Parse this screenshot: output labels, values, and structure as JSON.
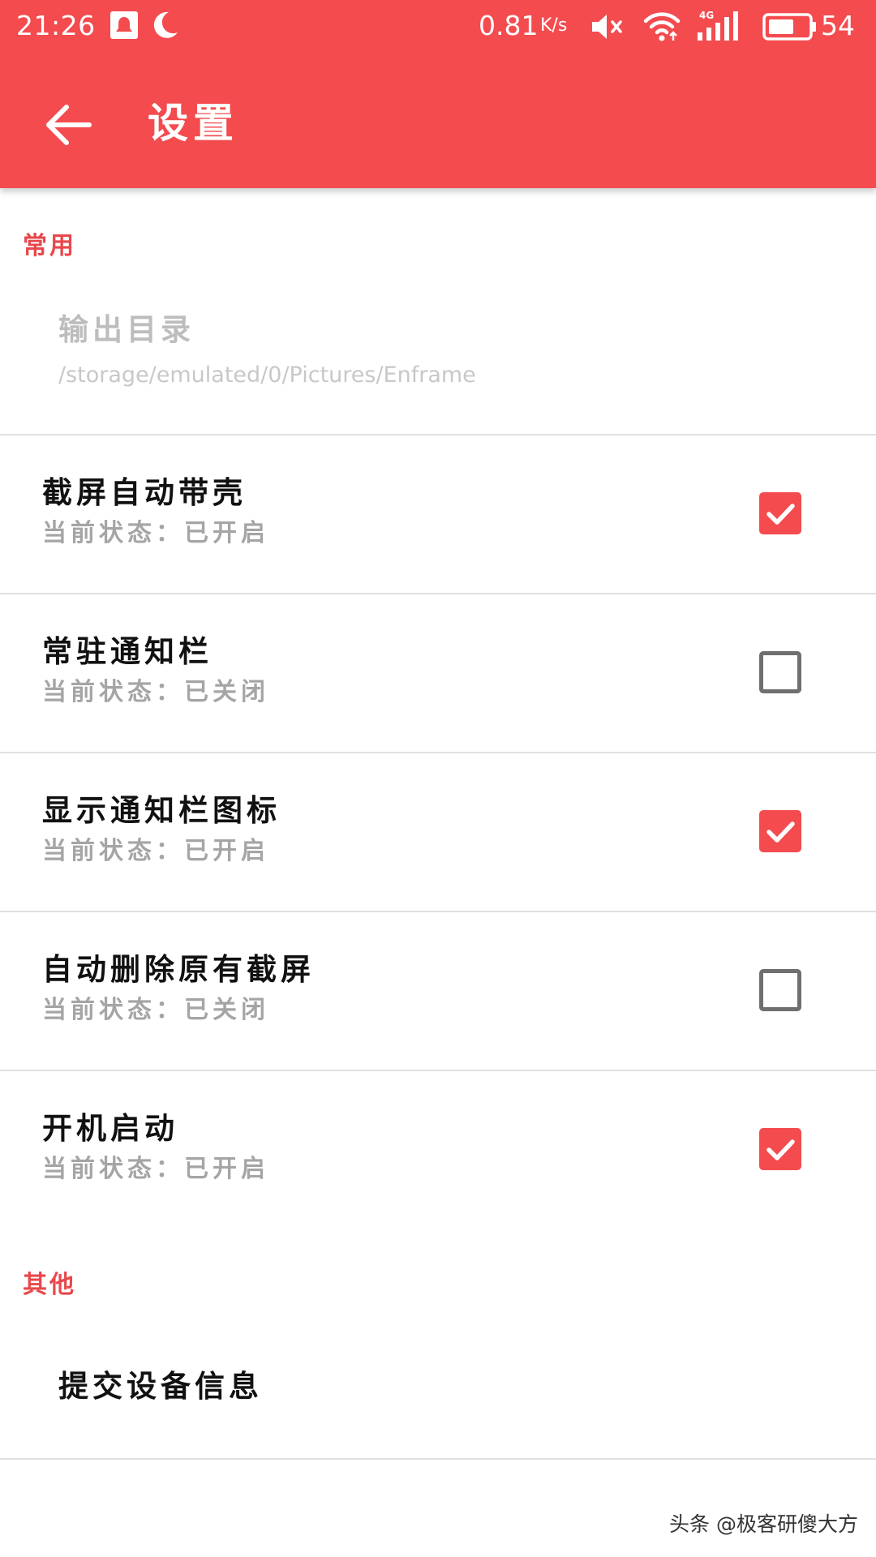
{
  "status_bar": {
    "time": "21:26",
    "net_speed": "0.81",
    "net_speed_unit": "K/s",
    "network_type": "4G",
    "battery_level": "54",
    "icons": [
      "notification-icon",
      "moon-icon",
      "mute-icon",
      "wifi-icon",
      "signal-icon",
      "battery-icon"
    ]
  },
  "toolbar": {
    "back_icon": "arrow-left-icon",
    "title": "设置"
  },
  "sections": {
    "common": {
      "header": "常用",
      "output_dir": {
        "title": "输出目录",
        "path": "/storage/emulated/0/Pictures/Enframe"
      },
      "items": [
        {
          "title": "截屏自动带壳",
          "summary": "当前状态：已开启",
          "checked": true
        },
        {
          "title": "常驻通知栏",
          "summary": "当前状态：已关闭",
          "checked": false
        },
        {
          "title": "显示通知栏图标",
          "summary": "当前状态：已开启",
          "checked": true
        },
        {
          "title": "自动删除原有截屏",
          "summary": "当前状态：已关闭",
          "checked": false
        },
        {
          "title": "开机启动",
          "summary": "当前状态：已开启",
          "checked": true
        }
      ]
    },
    "other": {
      "header": "其他",
      "submit_device_info": "提交设备信息"
    }
  },
  "watermark": "头条 @极客研傻大方",
  "colors": {
    "accent": "#f44b4f",
    "section_header": "#e8474b",
    "checkbox_off_border": "#6f6f6f"
  }
}
